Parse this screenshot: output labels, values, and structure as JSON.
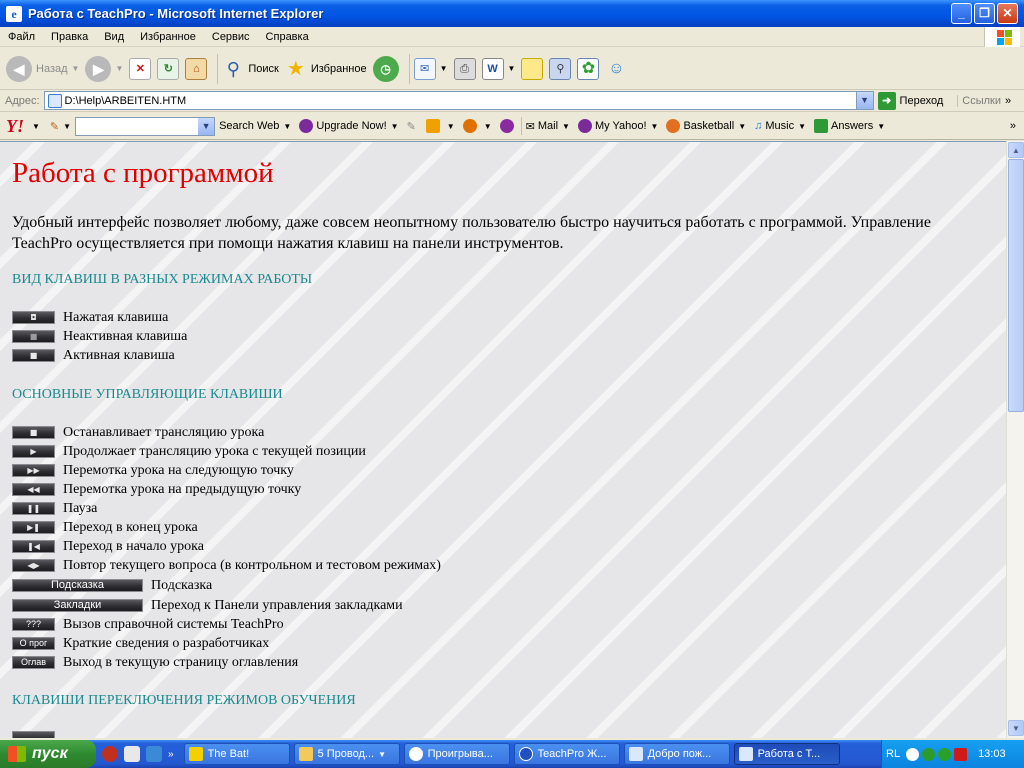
{
  "window": {
    "title": "Работа с TeachPro - Microsoft Internet Explorer"
  },
  "menu": [
    "Файл",
    "Правка",
    "Вид",
    "Избранное",
    "Сервис",
    "Справка"
  ],
  "toolbar": {
    "back": "Назад",
    "search": "Поиск",
    "favorites": "Избранное"
  },
  "address": {
    "label": "Адрес:",
    "value": "D:\\Help\\ARBEITEN.HTM",
    "go": "Переход",
    "links": "Ссылки"
  },
  "yahoo": {
    "search_web": "Search Web",
    "upgrade": "Upgrade Now!",
    "mail": "Mail",
    "my_yahoo": "My Yahoo!",
    "basketball": "Basketball",
    "music": "Music",
    "answers": "Answers"
  },
  "page": {
    "title": "Работа с программой",
    "intro": "Удобный интерфейс позволяет любому, даже совсем неопытному пользователю быстро научиться работать с программой. Управление TeachPro осуществляется при помощи нажатия клавиш на панели инструментов.",
    "section1": "ВИД КЛАВИШ В РАЗНЫХ РЕЖИМАХ РАБОТЫ",
    "modes": [
      {
        "glyph": "◘",
        "label": "Нажатая клавиша"
      },
      {
        "glyph": "■",
        "label": "Неактивная клавиша"
      },
      {
        "glyph": "■",
        "label": "Активная клавиша"
      }
    ],
    "section2": "ОСНОВНЫЕ УПРАВЛЯЮЩИЕ КЛАВИШИ",
    "keys": [
      {
        "glyph": "■",
        "label": "Останавливает трансляцию урока"
      },
      {
        "glyph": "▶",
        "label": "Продолжает трансляцию урока с текущей позиции"
      },
      {
        "glyph": "▶▶",
        "label": "Перемотка урока на следующую точку"
      },
      {
        "glyph": "◀◀",
        "label": "Перемотка урока на предыдущую точку"
      },
      {
        "glyph": "❚❚",
        "label": "Пауза"
      },
      {
        "glyph": "▶❚",
        "label": "Переход в конец урока"
      },
      {
        "glyph": "❚◀",
        "label": "Переход в начало урока"
      },
      {
        "glyph": "◀▶",
        "label": "Повтор текущего вопроса (в контрольном и тестовом режимах)"
      }
    ],
    "wide_keys": [
      {
        "glyph": "Подсказка",
        "label": "Подсказка"
      },
      {
        "glyph": "Закладки",
        "label": "Переход к Панели управления закладками"
      }
    ],
    "text_keys": [
      {
        "glyph": "???",
        "label": "Вызов справочной системы TeachPro"
      },
      {
        "glyph": "О прог",
        "label": "Краткие сведения о разработчиках"
      },
      {
        "glyph": "Оглав",
        "label": "Выход в текущую страницу оглавления"
      }
    ],
    "section3": "КЛАВИШИ ПЕРЕКЛЮЧЕНИЯ РЕЖИМОВ ОБУЧЕНИЯ"
  },
  "taskbar": {
    "start": "пуск",
    "tasks": [
      "The Bat!",
      "5 Провод...",
      "Проигрыва...",
      "TeachPro Ж...",
      "Добро пож...",
      "Работа с Т..."
    ],
    "lang": "RL",
    "clock": "13:03"
  }
}
